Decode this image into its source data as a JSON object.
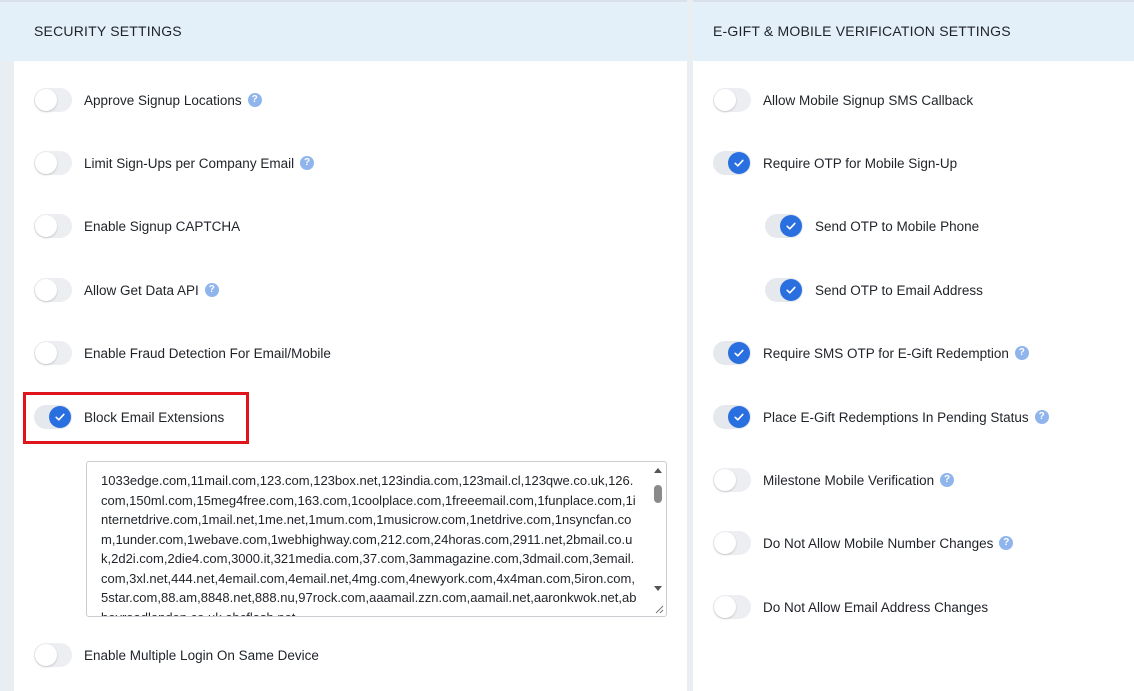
{
  "security": {
    "title": "SECURITY SETTINGS",
    "items": [
      {
        "label": "Approve Signup Locations",
        "on": false,
        "help": true
      },
      {
        "label": "Limit Sign-Ups per Company Email",
        "on": false,
        "help": true
      },
      {
        "label": "Enable Signup CAPTCHA",
        "on": false,
        "help": false
      },
      {
        "label": "Allow Get Data API",
        "on": false,
        "help": true
      },
      {
        "label": "Enable Fraud Detection For Email/Mobile",
        "on": false,
        "help": false
      },
      {
        "label": "Block Email Extensions",
        "on": true,
        "help": false
      },
      {
        "label": "Enable Multiple Login On Same Device",
        "on": false,
        "help": false
      }
    ],
    "blocked_extensions": "1033edge.com,11mail.com,123.com,123box.net,123india.com,123mail.cl,123qwe.co.uk,126.com,150ml.com,15meg4free.com,163.com,1coolplace.com,1freeemail.com,1funplace.com,1internetdrive.com,1mail.net,1me.net,1mum.com,1musicrow.com,1netdrive.com,1nsyncfan.com,1under.com,1webave.com,1webhighway.com,212.com,24horas.com,2911.net,2bmail.co.uk,2d2i.com,2die4.com,3000.it,321media.com,37.com,3ammagazine.com,3dmail.com,3email.com,3xl.net,444.net,4email.com,4email.net,4mg.com,4newyork.com,4x4man.com,5iron.com,5star.com,88.am,8848.net,888.nu,97rock.com,aaamail.zzn.com,aamail.net,aaronkwok.net,abbeyroadlondon.co.uk,abcflash.net"
  },
  "egift": {
    "title": "E-GIFT & MOBILE VERIFICATION SETTINGS",
    "items": [
      {
        "label": "Allow Mobile Signup SMS Callback",
        "on": false,
        "help": false
      },
      {
        "label": "Require OTP for Mobile Sign-Up",
        "on": true,
        "help": false
      },
      {
        "label": "Send OTP to Mobile Phone",
        "on": true,
        "help": false
      },
      {
        "label": "Send OTP to Email Address",
        "on": true,
        "help": false
      },
      {
        "label": "Require SMS OTP for E-Gift Redemption",
        "on": true,
        "help": true
      },
      {
        "label": "Place E-Gift Redemptions In Pending Status",
        "on": true,
        "help": true
      },
      {
        "label": "Milestone Mobile Verification",
        "on": false,
        "help": true
      },
      {
        "label": "Do Not Allow Mobile Number Changes",
        "on": false,
        "help": true
      },
      {
        "label": "Do Not Allow Email Address Changes",
        "on": false,
        "help": false
      }
    ]
  },
  "icons": {
    "help": "question-circle-icon",
    "check": "check-icon"
  },
  "help_glyph": "?",
  "colors": {
    "accent": "#2a6fe0",
    "highlight": "#e0151b",
    "header_bg": "#e3eff9",
    "help": "#8fb5ec"
  }
}
